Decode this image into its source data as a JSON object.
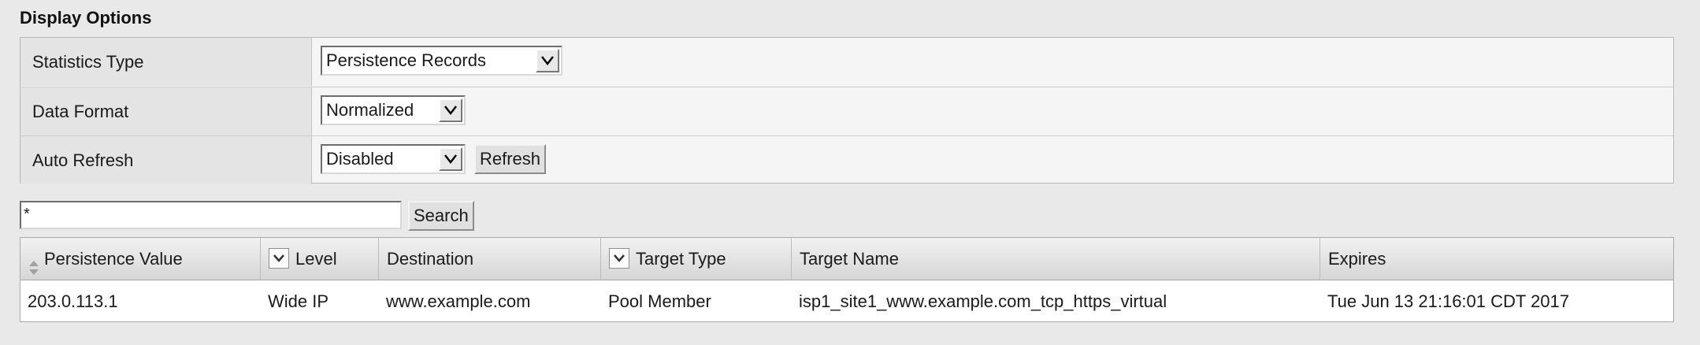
{
  "section_title": "Display Options",
  "options": [
    {
      "label": "Statistics Type",
      "control": {
        "type": "select",
        "value": "Persistence Records"
      }
    },
    {
      "label": "Data Format",
      "control": {
        "type": "select",
        "value": "Normalized"
      }
    },
    {
      "label": "Auto Refresh",
      "control": {
        "type": "select",
        "value": "Disabled"
      },
      "button": "Refresh"
    }
  ],
  "search": {
    "value": "*",
    "button": "Search"
  },
  "table": {
    "columns": [
      {
        "label": "Persistence Value",
        "icon": "sort-icon"
      },
      {
        "label": "Level",
        "icon": "filter-dropdown-icon"
      },
      {
        "label": "Destination",
        "icon": null
      },
      {
        "label": "Target Type",
        "icon": "filter-dropdown-icon"
      },
      {
        "label": "Target Name",
        "icon": null
      },
      {
        "label": "Expires",
        "icon": null
      }
    ],
    "rows": [
      [
        "203.0.113.1",
        "Wide IP",
        "www.example.com",
        "Pool Member",
        "isp1_site1_www.example.com_tcp_https_virtual",
        "Tue Jun 13 21:16:01 CDT 2017"
      ]
    ]
  }
}
